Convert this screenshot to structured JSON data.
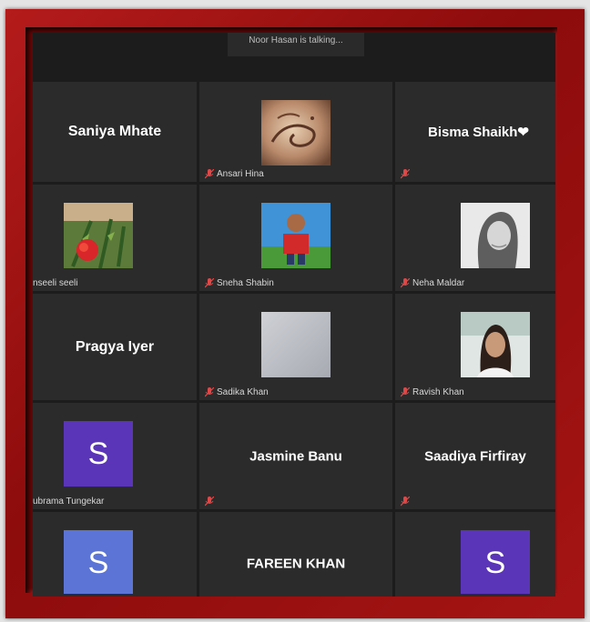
{
  "banner": {
    "text": "Noor Hasan is talking..."
  },
  "colors": {
    "frame": "#a51414",
    "tile": "#2b2b2b",
    "avatar_purple": "#5b35b8",
    "avatar_blue": "#5c74d6",
    "muted_mic": "#e04848"
  },
  "tiles": [
    {
      "display_name": "Saniya Mhate"
    },
    {
      "label": "Ansari Hina",
      "image": "calligraphy-art"
    },
    {
      "display_name": "Bisma  Shaikh❤ "
    },
    {
      "label": "nseeli seeli",
      "image": "red-flower-photo"
    },
    {
      "label": "Sneha Shabin",
      "image": "child-red-shirt-photo"
    },
    {
      "label": "Neha Maldar",
      "image": "woman-bw-photo"
    },
    {
      "display_name": "Pragya Iyer"
    },
    {
      "label": "Sadika Khan",
      "image": "grey-placeholder"
    },
    {
      "label": "Ravish Khan",
      "image": "woman-portrait-photo"
    },
    {
      "initial": "S",
      "label": "ubrama Tungekar"
    },
    {
      "display_name": "Jasmine Banu"
    },
    {
      "display_name": "Saadiya Firfiray"
    },
    {
      "initial": "S"
    },
    {
      "display_name": "FAREEN KHAN"
    },
    {
      "initial": "S"
    }
  ],
  "icons": {
    "mic": "muted-mic-icon"
  }
}
